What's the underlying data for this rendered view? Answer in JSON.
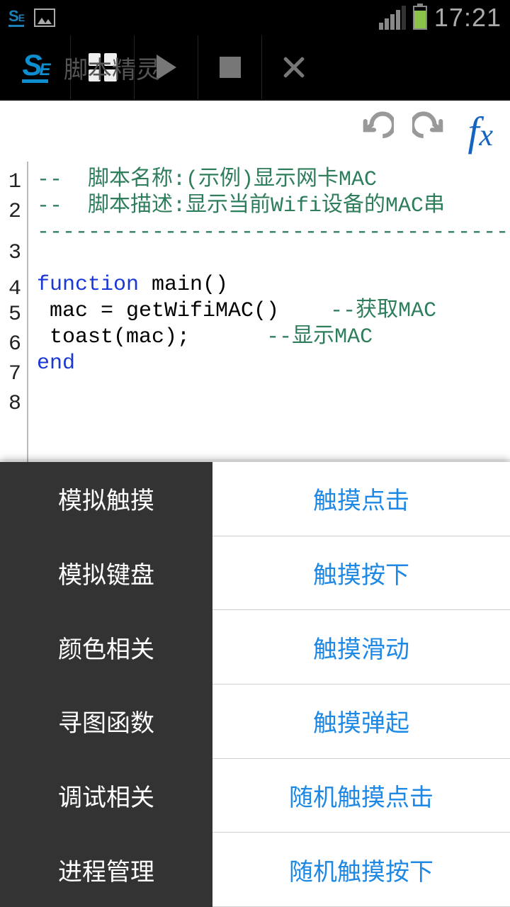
{
  "status": {
    "time": "17:21"
  },
  "app": {
    "title_behind": "脚本精灵"
  },
  "code": {
    "line1": "--  脚本名称:(示例)显示网卡MAC",
    "line2": "--  脚本描述:显示当前Wifi设备的MAC串",
    "line3": "------------------------------------------------------",
    "line4": "",
    "line5_kw": "function",
    "line5_rest": " main()",
    "line6_body": " mac = getWifiMAC()    ",
    "line6_comment": "--获取MAC",
    "line7_body": " toast(mac);      ",
    "line7_comment": "--显示MAC",
    "line8_kw": "end"
  },
  "lineNumbers": [
    "1",
    "2",
    "3",
    "4",
    "5",
    "6",
    "7",
    "8"
  ],
  "panel": {
    "categories": [
      "模拟触摸",
      "模拟键盘",
      "颜色相关",
      "寻图函数",
      "调试相关",
      "进程管理"
    ],
    "actions": [
      "触摸点击",
      "触摸按下",
      "触摸滑动",
      "触摸弹起",
      "随机触摸点击",
      "随机触摸按下"
    ]
  }
}
